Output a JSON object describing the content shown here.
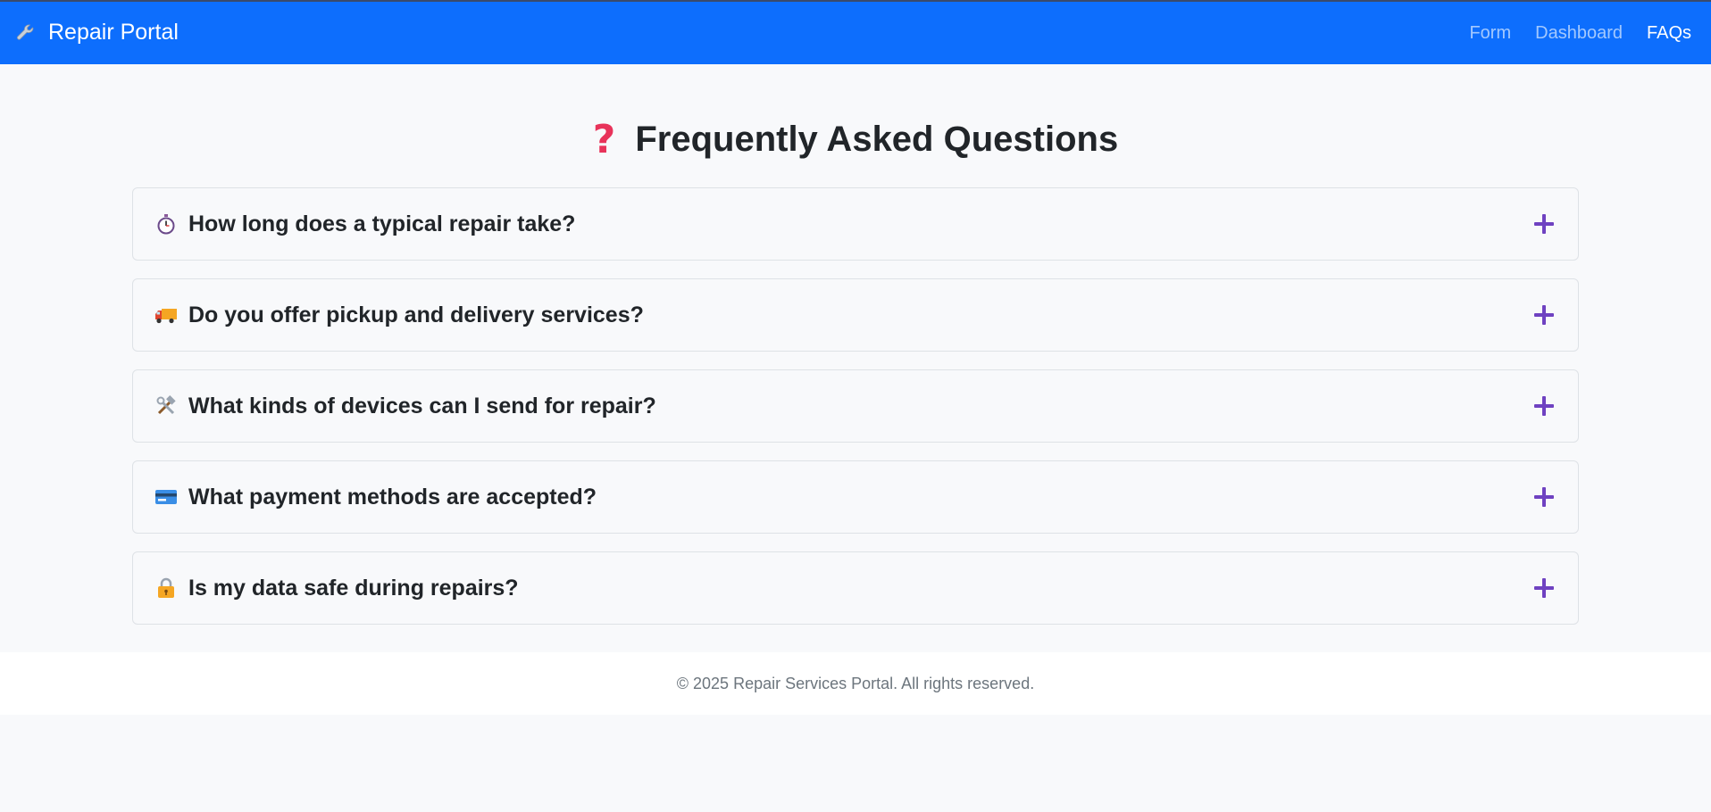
{
  "navbar": {
    "brand_icon": "wrench-icon",
    "brand_label": "Repair Portal",
    "links": [
      {
        "label": "Form",
        "active": false
      },
      {
        "label": "Dashboard",
        "active": false
      },
      {
        "label": "FAQs",
        "active": true
      }
    ],
    "background_color": "#0d6efd"
  },
  "page": {
    "title_icon": "question-mark-icon",
    "title": "Frequently Asked Questions"
  },
  "faqs": [
    {
      "icon": "stopwatch-icon",
      "question": "How long does a typical repair take?",
      "expanded": false
    },
    {
      "icon": "delivery-truck-icon",
      "question": "Do you offer pickup and delivery services?",
      "expanded": false
    },
    {
      "icon": "tools-icon",
      "question": "What kinds of devices can I send for repair?",
      "expanded": false
    },
    {
      "icon": "credit-card-icon",
      "question": "What payment methods are accepted?",
      "expanded": false
    },
    {
      "icon": "lock-icon",
      "question": "Is my data safe during repairs?",
      "expanded": false
    }
  ],
  "accordion": {
    "toggle_icon": "plus-icon",
    "toggle_color": "#6f42c1"
  },
  "footer": {
    "text": "© 2025 Repair Services Portal. All rights reserved."
  }
}
